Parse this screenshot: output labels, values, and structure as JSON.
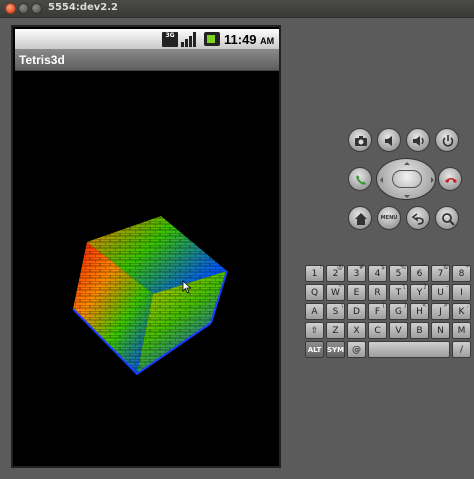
{
  "window": {
    "title": "5554:dev2.2"
  },
  "statusbar": {
    "network": "3G",
    "time": "11:49",
    "ampm": "AM"
  },
  "app": {
    "title": "Tetris3d"
  },
  "controls": {
    "camera": "camera-icon",
    "volume_down": "volume-down-icon",
    "volume_up": "volume-up-icon",
    "power": "power-icon",
    "call": "call-icon",
    "end_call": "end-call-icon",
    "home": "home-icon",
    "menu_label": "MENU",
    "back": "back-icon",
    "search": "search-icon"
  },
  "keyboard": {
    "row1": [
      {
        "k": "1",
        "s": "!"
      },
      {
        "k": "2",
        "s": "@"
      },
      {
        "k": "3",
        "s": "#"
      },
      {
        "k": "4",
        "s": "$"
      },
      {
        "k": "5",
        "s": "%"
      },
      {
        "k": "6",
        "s": "^"
      },
      {
        "k": "7",
        "s": "&"
      },
      {
        "k": "8",
        "s": "*"
      }
    ],
    "row2": [
      {
        "k": "Q",
        "s": ""
      },
      {
        "k": "W",
        "s": "~"
      },
      {
        "k": "E",
        "s": "\""
      },
      {
        "k": "R",
        "s": ""
      },
      {
        "k": "T",
        "s": "{"
      },
      {
        "k": "Y",
        "s": "}"
      },
      {
        "k": "U",
        "s": "-"
      },
      {
        "k": "I",
        "s": ""
      }
    ],
    "row3": [
      {
        "k": "A",
        "s": ""
      },
      {
        "k": "S",
        "s": "\\"
      },
      {
        "k": "D",
        "s": "'"
      },
      {
        "k": "F",
        "s": "["
      },
      {
        "k": "G",
        "s": "]"
      },
      {
        "k": "H",
        "s": "<"
      },
      {
        "k": "J",
        "s": ">"
      },
      {
        "k": "K",
        "s": ";"
      }
    ],
    "row4": [
      {
        "k": "⇧",
        "s": ""
      },
      {
        "k": "Z",
        "s": ""
      },
      {
        "k": "X",
        "s": ""
      },
      {
        "k": "C",
        "s": ""
      },
      {
        "k": "V",
        "s": ""
      },
      {
        "k": "B",
        "s": ""
      },
      {
        "k": "N",
        "s": ""
      },
      {
        "k": "M",
        "s": ""
      }
    ],
    "row5": {
      "alt": "ALT",
      "sym": "SYM",
      "at": "@",
      "space": "",
      "slash": "/"
    }
  }
}
